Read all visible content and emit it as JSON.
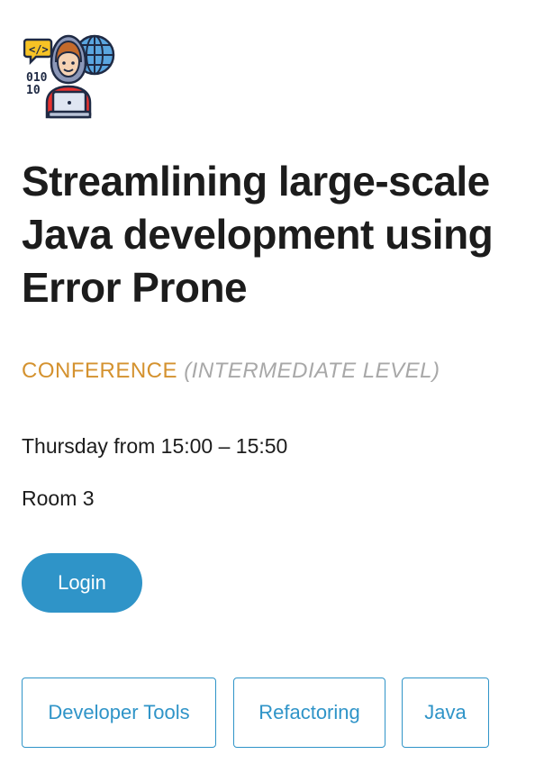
{
  "session": {
    "title": "Streamlining large-scale Java development using Error Prone",
    "type": "CONFERENCE",
    "level": "(INTERMEDIATE LEVEL)",
    "time": "Thursday from 15:00 – 15:50",
    "room": "Room 3"
  },
  "actions": {
    "login_label": "Login"
  },
  "tags": [
    "Developer Tools",
    "Refactoring",
    "Java"
  ],
  "icon": {
    "name": "developer-avatar-icon"
  },
  "colors": {
    "accent": "#2f94c8",
    "type": "#d4922f",
    "level": "#a8a8a8",
    "text": "#1c1c1c"
  }
}
